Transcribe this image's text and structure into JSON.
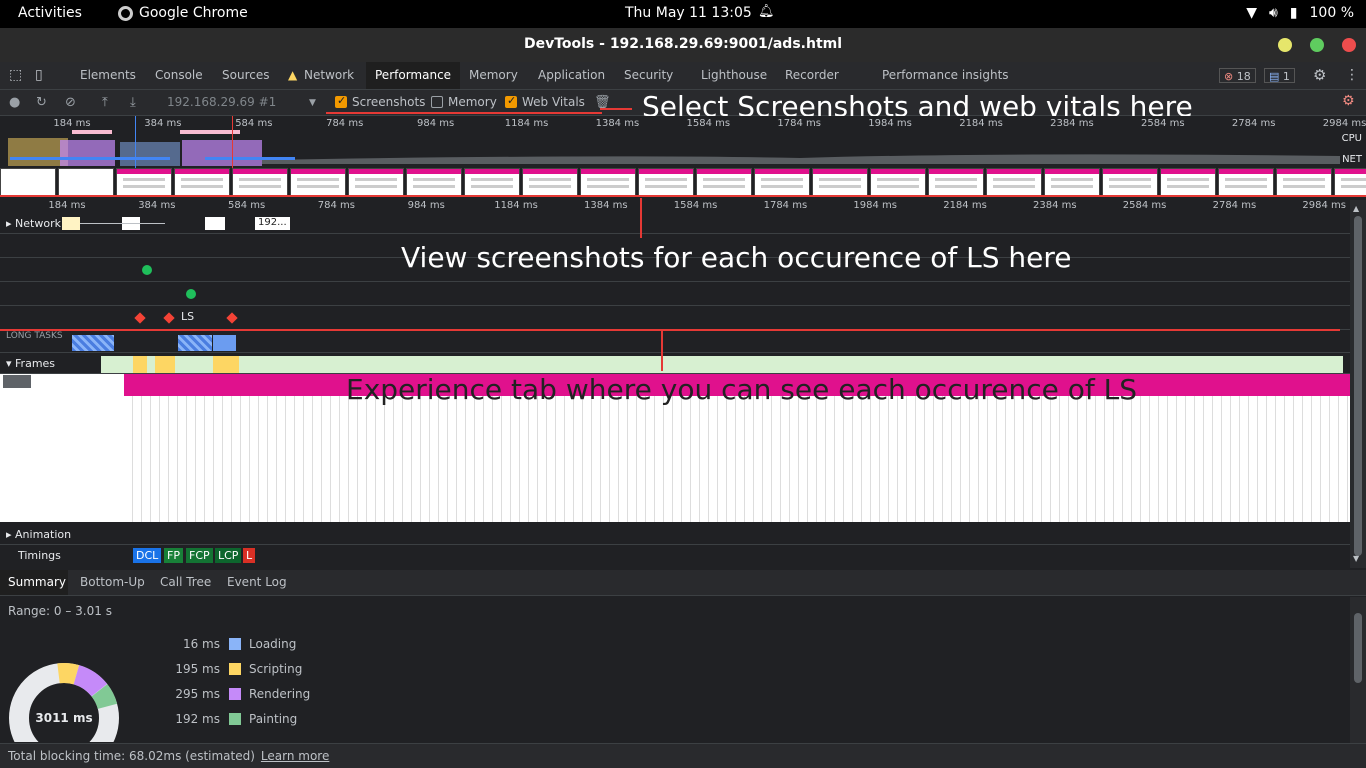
{
  "os": {
    "activities": "Activities",
    "app": "Google Chrome",
    "clock": "Thu May 11  13:05",
    "battery": "100 %"
  },
  "window": {
    "title": "DevTools - 192.168.29.69:9001/ads.html"
  },
  "tabs": [
    "Elements",
    "Console",
    "Sources",
    "Network",
    "Performance",
    "Memory",
    "Application",
    "Security",
    "Lighthouse",
    "Recorder",
    "Performance insights"
  ],
  "badges": {
    "errors": "18",
    "messages": "1"
  },
  "toolbar": {
    "profile": "192.168.29.69 #1",
    "screenshots": "Screenshots",
    "memory": "Memory",
    "web_vitals": "Web Vitals"
  },
  "annotations": {
    "a1": "Select Screenshots and web vitals here",
    "a2": "View screenshots for each occurence of LS here",
    "a3": "Experience tab where you can see each occurence of LS"
  },
  "ruler_ticks": [
    "184 ms",
    "384 ms",
    "584 ms",
    "784 ms",
    "984 ms",
    "1184 ms",
    "1384 ms",
    "1584 ms",
    "1784 ms",
    "1984 ms",
    "2184 ms",
    "2384 ms",
    "2584 ms",
    "2784 ms",
    "2984 ms"
  ],
  "overview_labels": {
    "cpu": "CPU",
    "net": "NET"
  },
  "tracks": {
    "network": "Network",
    "network_req": "192...",
    "ls": "LS",
    "long_tasks": "LONG TASKS",
    "frames": "Frames",
    "animation": "Animation",
    "timings": "Timings"
  },
  "timings": [
    "DCL",
    "FP",
    "FCP",
    "LCP",
    "L"
  ],
  "bottom_tabs": [
    "Summary",
    "Bottom-Up",
    "Call Tree",
    "Event Log"
  ],
  "summary": {
    "range": "Range: 0 – 3.01 s",
    "total": "3011 ms",
    "rows": [
      {
        "value": "16 ms",
        "name": "Loading",
        "color": "#8ab4f8"
      },
      {
        "value": "195 ms",
        "name": "Scripting",
        "color": "#fdd663"
      },
      {
        "value": "295 ms",
        "name": "Rendering",
        "color": "#c58af9"
      },
      {
        "value": "192 ms",
        "name": "Painting",
        "color": "#81c995"
      }
    ]
  },
  "footer": {
    "text": "Total blocking time: 68.02ms (estimated)",
    "link": "Learn more"
  }
}
